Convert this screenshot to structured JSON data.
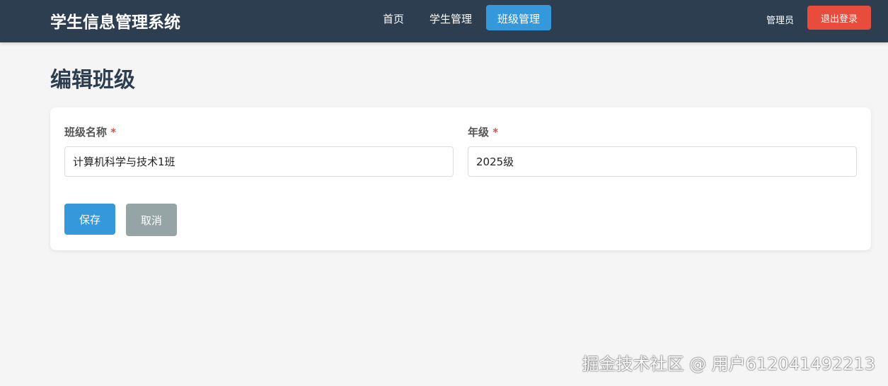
{
  "header": {
    "brand": "学生信息管理系统",
    "nav": [
      "首页",
      "学生管理",
      "班级管理"
    ],
    "user": "管理员",
    "logout": "退出登录"
  },
  "page": {
    "title": "编辑班级"
  },
  "form": {
    "name_label": "班级名称",
    "name_value": "计算机科学与技术1班",
    "grade_label": "年级",
    "grade_value": "2025级",
    "required": "*",
    "save": "保存",
    "cancel": "取消"
  },
  "watermark": "掘金技术社区 @ 用户612041492213"
}
